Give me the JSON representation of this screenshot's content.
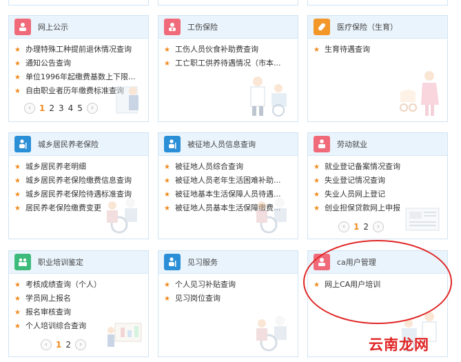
{
  "cards": [
    {
      "title": "网上公示",
      "icon_color": "#f06a7a",
      "icon": "monitor-user-icon",
      "items": [
        "办理特殊工种提前退休情况查询",
        "通知公告查询",
        "单位1996年起缴费基数上下限...",
        "自由职业者历年缴费标准查询"
      ],
      "pager": [
        "1",
        "2",
        "3",
        "4",
        "5"
      ],
      "active_page": "1"
    },
    {
      "title": "工伤保险",
      "icon_color": "#f06a7a",
      "icon": "injury-user-icon",
      "items": [
        "工伤人员伙食补助费查询",
        "工亡职工供养待遇情况（市本..."
      ]
    },
    {
      "title": "医疗保险（生育）",
      "icon_color": "#f3972a",
      "icon": "medicine-icon",
      "items": [
        "生育待遇查询"
      ]
    },
    {
      "title": "城乡居民养老保险",
      "icon_color": "#2a8fd6",
      "icon": "elder-user-icon",
      "items": [
        "城乡居民养老明细",
        "城乡居民养老保险缴费信息查询",
        "城乡居民养老保险待遇标准查询",
        "居民养老保险缴费变更"
      ]
    },
    {
      "title": "被征地人员信息查询",
      "icon_color": "#2a8fd6",
      "icon": "land-user-icon",
      "items": [
        "被征地人员综合查询",
        "被征地人员老年生活困难补助...",
        "被征地基本生活保障人员待遇...",
        "被征地人员基本生活保障缴费..."
      ]
    },
    {
      "title": "劳动就业",
      "icon_color": "#f06a7a",
      "icon": "employment-icon",
      "items": [
        "就业登记备案情况查询",
        "失业登记情况查询",
        "失业人员网上登记",
        "创业担保贷款网上申报"
      ],
      "pager": [
        "1",
        "2"
      ],
      "active_page": "1"
    },
    {
      "title": "职业培训鉴定",
      "icon_color": "#3dbb7a",
      "icon": "training-icon",
      "items": [
        "考核成绩查询（个人）",
        "学员网上报名",
        "报名审核查询",
        "个人培训综合查询"
      ],
      "pager": [
        "1",
        "2"
      ],
      "active_page": "1"
    },
    {
      "title": "见习服务",
      "icon_color": "#2a8fd6",
      "icon": "intern-icon",
      "items": [
        "个人见习补贴查询",
        "见习岗位查询"
      ]
    },
    {
      "title": "ca用户管理",
      "icon_color": "#f06a7a",
      "icon": "ca-user-icon",
      "items": [
        "网上CA用户培训"
      ]
    }
  ],
  "pager_prev": "‹",
  "pager_next": "›",
  "star": "★",
  "watermark": "云南龙网",
  "highlight_color": "#e02424"
}
